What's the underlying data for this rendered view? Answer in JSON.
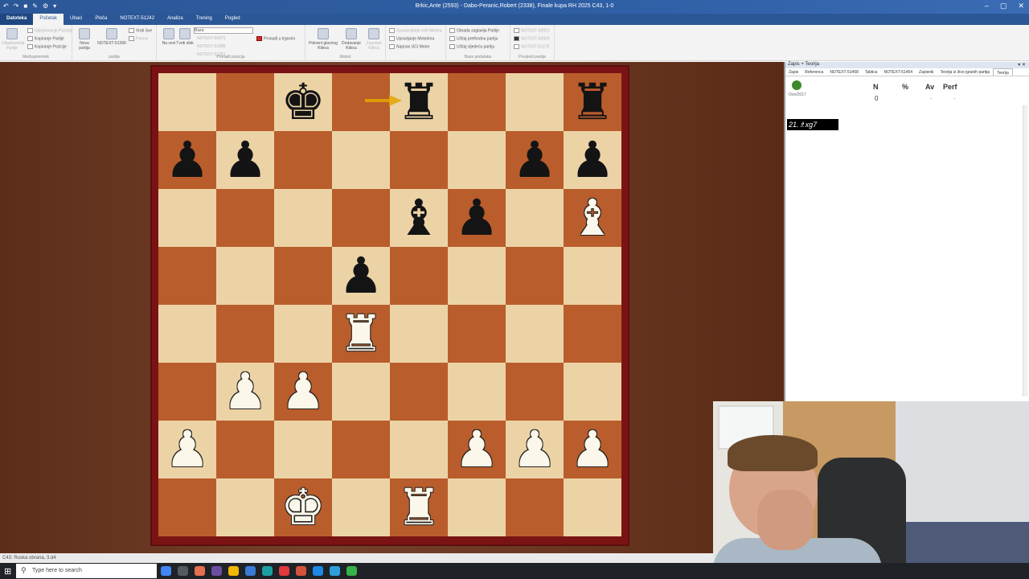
{
  "titlebar": {
    "title": "Brkic,Ante (2593) - Dabo-Peranic,Robert (2338), Finale kupa RH 2025  C43, 1-0",
    "qa_icons": [
      "↶",
      "↷",
      "■",
      "✎",
      "⚙",
      "▾"
    ],
    "win_min": "–",
    "win_max": "▢",
    "win_close": "✕"
  },
  "ribbon_tabs": [
    "Datoteka",
    "Početak",
    "Ubaci",
    "Ploča",
    "NOTEXT-51242",
    "Analiza",
    "Trening",
    "Pogled"
  ],
  "ribbon": {
    "g1": {
      "items": [
        "Uljepšavanje Pozicije",
        "Kopiranje Partije",
        "Kopiranje Pozicije"
      ],
      "big": "Uljepšavanje Partije",
      "caption": "Međuspremnik"
    },
    "g2": {
      "big1": "Nova partija",
      "big2": "NOTEXT-51390",
      "items": [
        "Vrati Sve",
        "Ponovi"
      ],
      "caption": "partija"
    },
    "g3": {
      "big1": "Na vezi",
      "big2": "Tvrdi disk",
      "dropdown": "Baza",
      "items": [
        "NOTEXT-50971",
        "NOTEXT-51085",
        "NOTEXT-51351"
      ],
      "extra": "Pronađi u trgovini",
      "caption": "Pronađi poziciju"
    },
    "g4": {
      "big1": "Pokreni glavnog Kibica",
      "big2": "Dodavanje Kibica",
      "big3": "Zaustavi Kibica",
      "caption": "Motori"
    },
    "g5": {
      "items": [
        "Zaustavljanje svih Motora",
        "Upravljanje Motorima",
        "Napravi UCI Motor"
      ],
      "caption": ""
    },
    "g6": {
      "items": [
        "Obrada zaglavlja Partije",
        "Učitaj prethodnu partiju",
        "Učitaj sljedeću partiju"
      ],
      "caption": "Baze podataka"
    },
    "g7": {
      "items": [
        "NOTEXT-50921",
        "NOTEXT-50920",
        "NOTEXT-51179"
      ],
      "caption": "Povijesti partija"
    }
  },
  "board": {
    "rows": [
      [
        "",
        "",
        "bk",
        "",
        "br",
        "",
        "",
        "br"
      ],
      [
        "bp",
        "bp",
        "",
        "",
        "",
        "",
        "bp",
        "bp"
      ],
      [
        "",
        "",
        "",
        "",
        "bb",
        "bp",
        "",
        "wb"
      ],
      [
        "",
        "",
        "",
        "bp",
        "",
        "",
        "",
        ""
      ],
      [
        "",
        "",
        "",
        "wr",
        "",
        "",
        "",
        ""
      ],
      [
        "",
        "wp",
        "wp",
        "",
        "",
        "",
        "",
        ""
      ],
      [
        "wp",
        "",
        "",
        "",
        "",
        "wp",
        "wp",
        "wp"
      ],
      [
        "",
        "",
        "wk",
        "",
        "wr",
        "",
        "",
        ""
      ]
    ],
    "glyphs": {
      "k": "♚",
      "q": "♛",
      "r": "♜",
      "b": "♝",
      "n": "♞",
      "p": "♟"
    },
    "light": "#ecd3a6",
    "dark": "#b95d2c",
    "arrow_color": "#e5a400"
  },
  "panel": {
    "header": "Zapis + Teorija",
    "close": "▾ ✕",
    "tabs": [
      "Zapis",
      "Referenca",
      "NOTEXT-51458",
      "Tablica",
      "NOTEXT-51454",
      "Zapisnik",
      "Teorija iz živo igranih partija",
      "Teorija"
    ],
    "tree_label": "Ovo/2017",
    "columns": [
      "N",
      "%",
      "Av",
      "Perf"
    ],
    "row": {
      "n": "0",
      "pct": "",
      "av": "-",
      "perf": "-"
    },
    "move": "21.♗xg7"
  },
  "statusbar": {
    "text": "C43: Ruska obrana, 3.d4"
  },
  "taskbar": {
    "start": "⊞",
    "search_icon": "⚲",
    "search_placeholder": "Type here to search",
    "apps": [
      "#4285f4",
      "#555a60",
      "#e76f51",
      "#6b4ea0",
      "#f2b705",
      "#3a7bd5",
      "#1ca0a4",
      "#e0393e",
      "#d4533b",
      "#1e88e5",
      "#2d9fdb",
      "#35b34a"
    ]
  }
}
